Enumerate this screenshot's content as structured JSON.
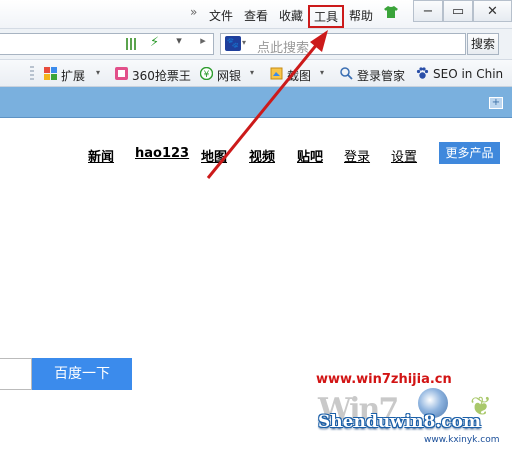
{
  "menu": {
    "chevron": "»",
    "items": [
      "文件",
      "查看",
      "收藏",
      "工具",
      "帮助"
    ],
    "highlighted": "工具"
  },
  "window_controls": {
    "minimize": "−",
    "restore": "▭",
    "close": "✕"
  },
  "address_bar": {
    "search_placeholder": "点此搜索",
    "search_button": "搜索",
    "dropdown_glyph": "▾",
    "go_glyph": "▸"
  },
  "bookmarks": {
    "items": [
      {
        "label": "扩展"
      },
      {
        "label": "360抢票王"
      },
      {
        "label": "网银"
      },
      {
        "label": "截图"
      },
      {
        "label": "登录管家"
      },
      {
        "label": "SEO in Chin"
      }
    ]
  },
  "page": {
    "nav_links": [
      "新闻",
      "hao123",
      "地图",
      "视频",
      "贴吧",
      "登录",
      "设置"
    ],
    "more_products": "更多产品",
    "search_button": "百度一下"
  },
  "annotation": {
    "arrow_color": "#cc1a1a"
  },
  "watermark": {
    "url": "www.win7zhijia.cn",
    "logo_text": "Win7",
    "site": "Shenduwin8.com",
    "sub": "www.kxinyk.com"
  },
  "colors": {
    "tab_strip": "#7ab0de",
    "accent_button": "#3b8bec",
    "highlight_border": "#cc1a1a"
  }
}
